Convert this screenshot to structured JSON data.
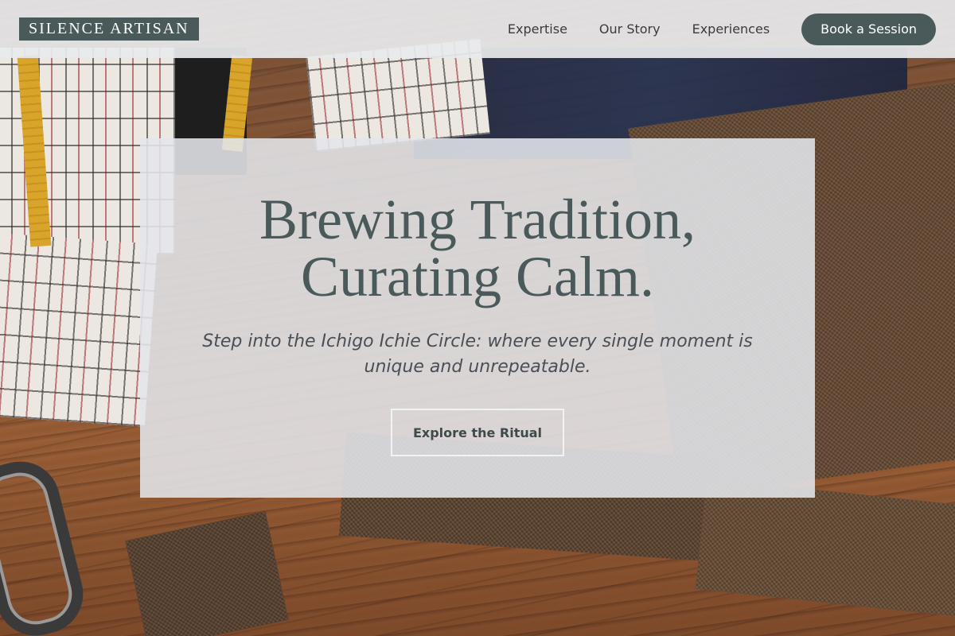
{
  "header": {
    "logo": "SILENCE ARTISAN",
    "nav": [
      {
        "label": "Expertise"
      },
      {
        "label": "Our Story"
      },
      {
        "label": "Experiences"
      }
    ],
    "cta_label": "Book a Session"
  },
  "hero": {
    "title_line1": "Brewing Tradition,",
    "title_line2": "Curating Calm.",
    "subtitle": "Step into the Ichigo Ichie Circle: where every single moment is unique and unrepeatable.",
    "button_label": "Explore the Ritual"
  },
  "colors": {
    "brand": "#4a5a5a",
    "header_bg": "#e8eaec",
    "hero_bg": "#e4e6ea"
  }
}
